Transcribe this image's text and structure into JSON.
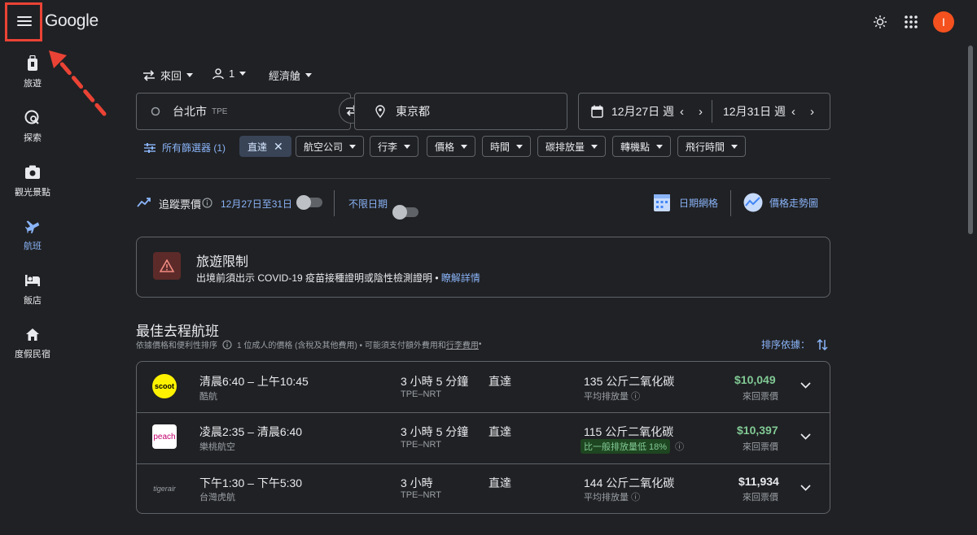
{
  "header": {
    "logo": "Google"
  },
  "sidebar": {
    "items": [
      {
        "label": "旅遊",
        "icon": "luggage-icon"
      },
      {
        "label": "探索",
        "icon": "explore-icon"
      },
      {
        "label": "觀光景點",
        "icon": "camera-icon"
      },
      {
        "label": "航班",
        "icon": "flight-icon"
      },
      {
        "label": "飯店",
        "icon": "hotel-icon"
      },
      {
        "label": "度假民宿",
        "icon": "home-icon"
      }
    ]
  },
  "search": {
    "trip_type": "來回",
    "passengers": "1",
    "cabin": "經濟艙",
    "origin_city": "台北市",
    "origin_code": "TPE",
    "destination": "東京都",
    "depart_date": "12月27日 週",
    "return_date": "12月31日 週"
  },
  "filters": {
    "all_filters": "所有篩選器 (1)",
    "nonstop": "直達",
    "airlines": "航空公司",
    "bags": "行李",
    "price": "價格",
    "times": "時間",
    "emissions": "碳排放量",
    "connecting": "轉機點",
    "duration": "飛行時間"
  },
  "tracking": {
    "track_prices": "追蹤票價",
    "date_range": "12月27日至31日",
    "any_dates": "不限日期",
    "date_grid": "日期網格",
    "price_graph": "價格走勢圖"
  },
  "alert": {
    "title": "旅遊限制",
    "text": "出境前須出示 COVID-19 疫苗接種證明或陰性檢測證明 •",
    "link": "瞭解詳情"
  },
  "results": {
    "title": "最佳去程航班",
    "subtitle_a": "依據價格和便利性排序",
    "subtitle_b": "1 位成人的價格 (含稅及其他費用) • 可能須支付額外費用和",
    "subtitle_link": "行李費用",
    "subtitle_end": " •",
    "sort_label": "排序依據：",
    "flights": [
      {
        "times": "清晨6:40 – 上午10:45",
        "airline": "酷航",
        "duration": "3 小時 5 分鐘",
        "route": "TPE–NRT",
        "stops": "直達",
        "emissions": "135 公斤二氧化碳",
        "emissions_note": "平均排放量",
        "price": "$10,049",
        "price_note": "來回票價",
        "logo_text": "scoot"
      },
      {
        "times": "凌晨2:35 – 清晨6:40",
        "airline": "樂桃航空",
        "duration": "3 小時 5 分鐘",
        "route": "TPE–NRT",
        "stops": "直達",
        "emissions": "115 公斤二氧化碳",
        "emissions_note": "比一般排放量低 18%",
        "price": "$10,397",
        "price_note": "來回票價",
        "logo_text": "peach"
      },
      {
        "times": "下午1:30 – 下午5:30",
        "airline": "台灣虎航",
        "duration": "3 小時",
        "route": "TPE–NRT",
        "stops": "直達",
        "emissions": "144 公斤二氧化碳",
        "emissions_note": "平均排放量",
        "price": "$11,934",
        "price_note": "來回票價",
        "logo_text": "tigerair"
      }
    ]
  },
  "colors": {
    "accent": "#8ab4f8",
    "green": "#81c995",
    "annotation": "#ea4335"
  }
}
